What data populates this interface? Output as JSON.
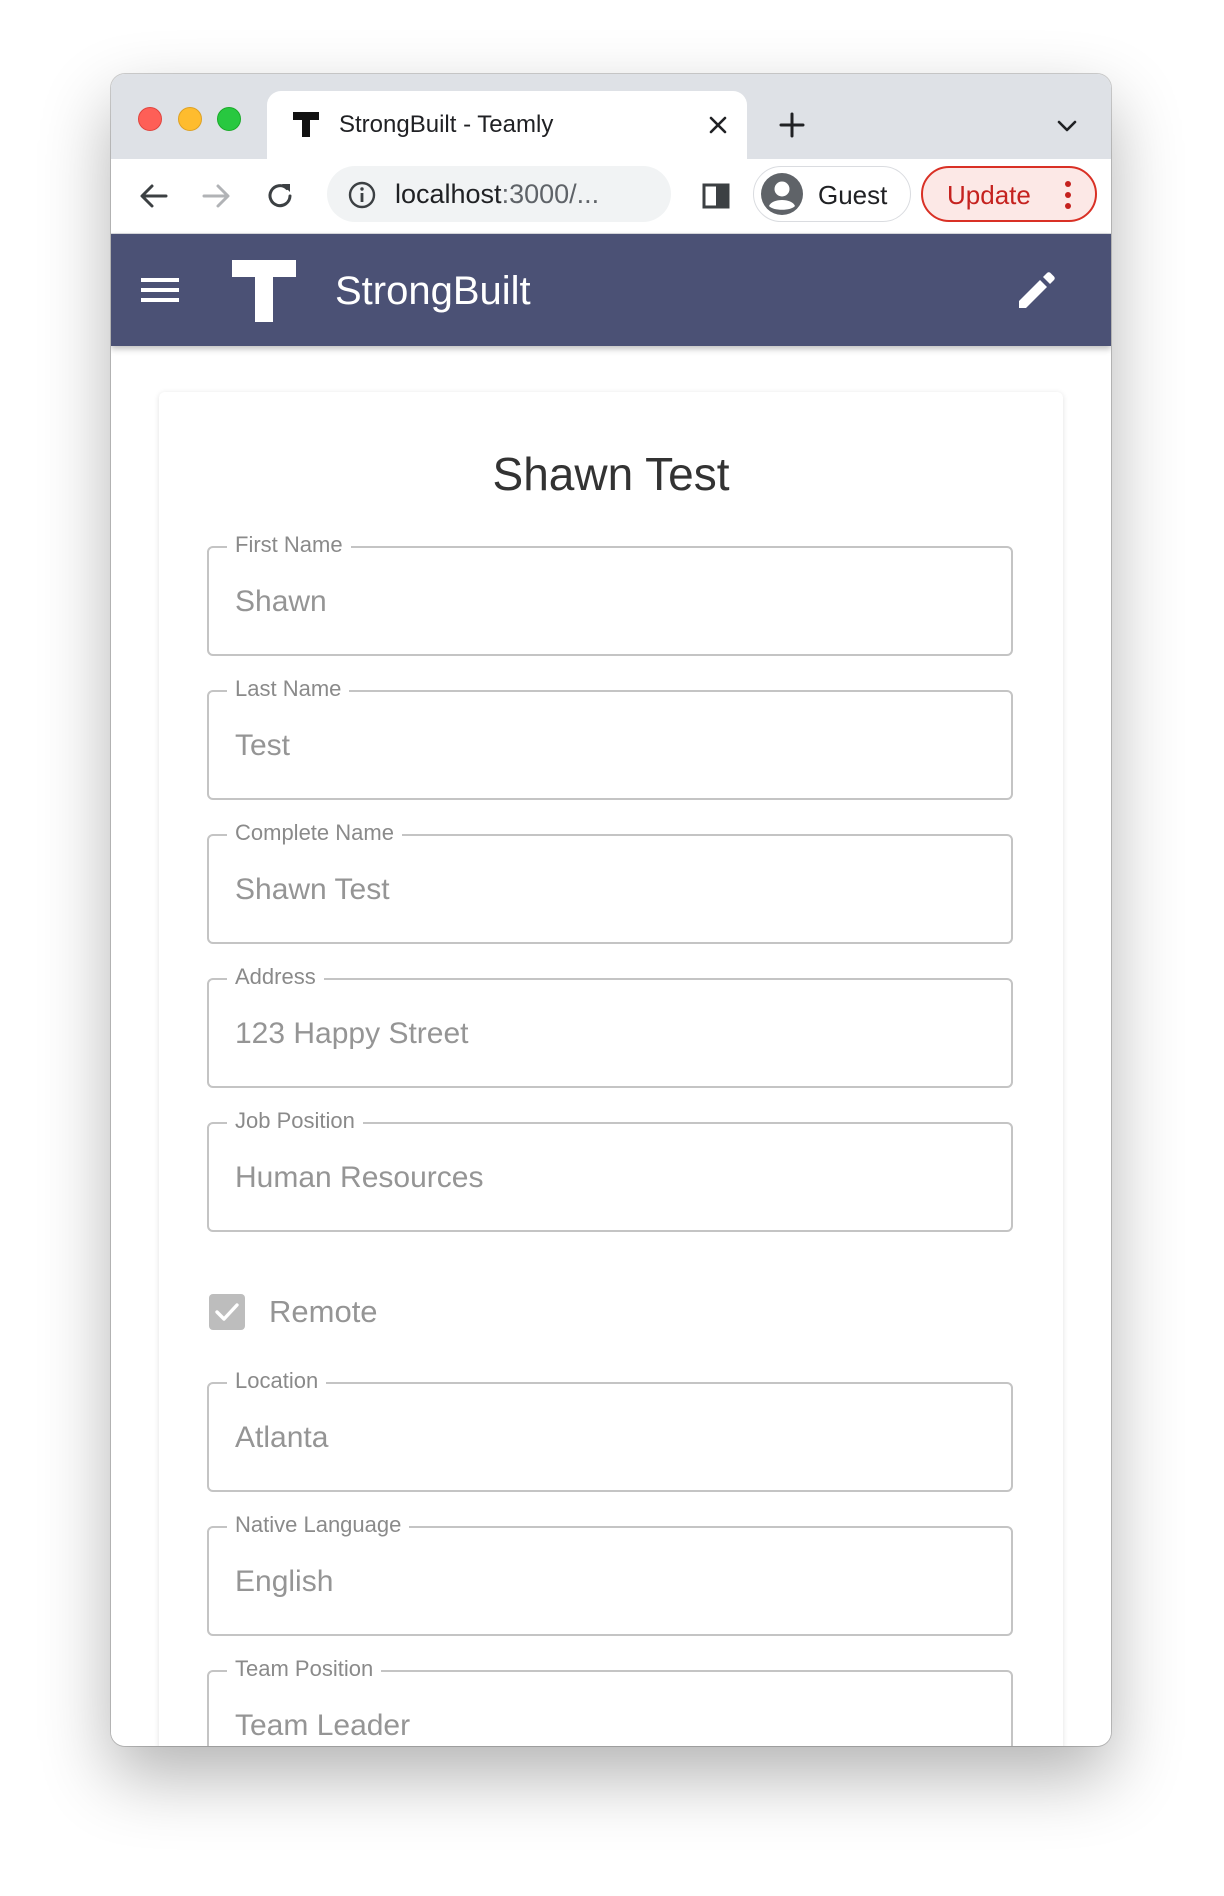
{
  "browser": {
    "tab": {
      "title": "StrongBuilt - Teamly"
    },
    "address": {
      "url_host": "localhost",
      "url_rest": ":3000/..."
    },
    "profile_label": "Guest",
    "update_label": "Update"
  },
  "app": {
    "title": "StrongBuilt",
    "bar_color": "#4b5175"
  },
  "form": {
    "title": "Shawn Test",
    "fields": [
      {
        "label": "First Name",
        "value": "Shawn"
      },
      {
        "label": "Last Name",
        "value": "Test"
      },
      {
        "label": "Complete Name",
        "value": "Shawn Test"
      },
      {
        "label": "Address",
        "value": "123 Happy Street"
      },
      {
        "label": "Job Position",
        "value": "Human Resources"
      },
      {
        "label": "Location",
        "value": "Atlanta"
      },
      {
        "label": "Native Language",
        "value": "English"
      },
      {
        "label": "Team Position",
        "value": "Team Leader"
      }
    ],
    "remote": {
      "label": "Remote",
      "checked": true
    }
  }
}
